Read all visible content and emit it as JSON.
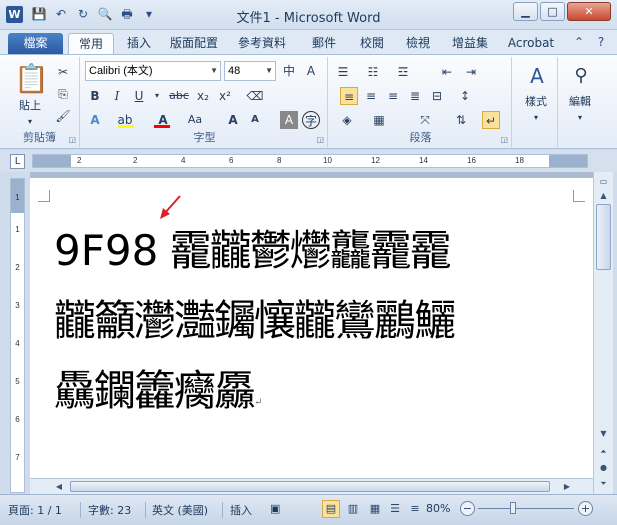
{
  "window": {
    "title": "文件1 - Microsoft Word",
    "app_icon_letter": "W",
    "controls": {
      "minimize": "▁",
      "maximize": "□",
      "close": "✕"
    }
  },
  "qat": {
    "icons": [
      "save-icon",
      "undo-icon",
      "redo-icon",
      "print-preview-icon",
      "print-icon",
      "customize-icon"
    ]
  },
  "tabs": {
    "file": "檔案",
    "items": [
      "常用",
      "插入",
      "版面配置",
      "參考資料",
      "郵件",
      "校閱",
      "檢視",
      "增益集",
      "Acrobat"
    ],
    "active_index": 0
  },
  "ribbon": {
    "clipboard": {
      "label": "剪貼簿",
      "paste": "貼上"
    },
    "font": {
      "label": "字型",
      "font_name": "Calibri (本文)",
      "font_size": "48"
    },
    "paragraph": {
      "label": "段落"
    },
    "styles": {
      "button": "樣式"
    },
    "editing": {
      "button": "編輯"
    }
  },
  "ruler": {
    "h_numbers": [
      "2",
      "2",
      "4",
      "6",
      "8",
      "10",
      "12",
      "14",
      "16",
      "18"
    ],
    "v_numbers": [
      "1",
      "1",
      "2",
      "3",
      "4",
      "5",
      "6",
      "7"
    ]
  },
  "document": {
    "hex_code": "9F98",
    "line1": "靇龖鬱爩龘龗靇",
    "line2": "龖籲灪灎钃懹龖鸞鸝鱺",
    "line3": "驫鑭籱癵厵",
    "pilcrow": "↵"
  },
  "status": {
    "page": "頁面: 1 / 1",
    "words": "字數: 23",
    "language": "英文 (美國)",
    "mode": "插入",
    "zoom": "80%"
  },
  "colors": {
    "highlight": "#ffff00",
    "font_color": "#ff0000",
    "accent": "#2b5797",
    "arrow": "#e02020"
  }
}
